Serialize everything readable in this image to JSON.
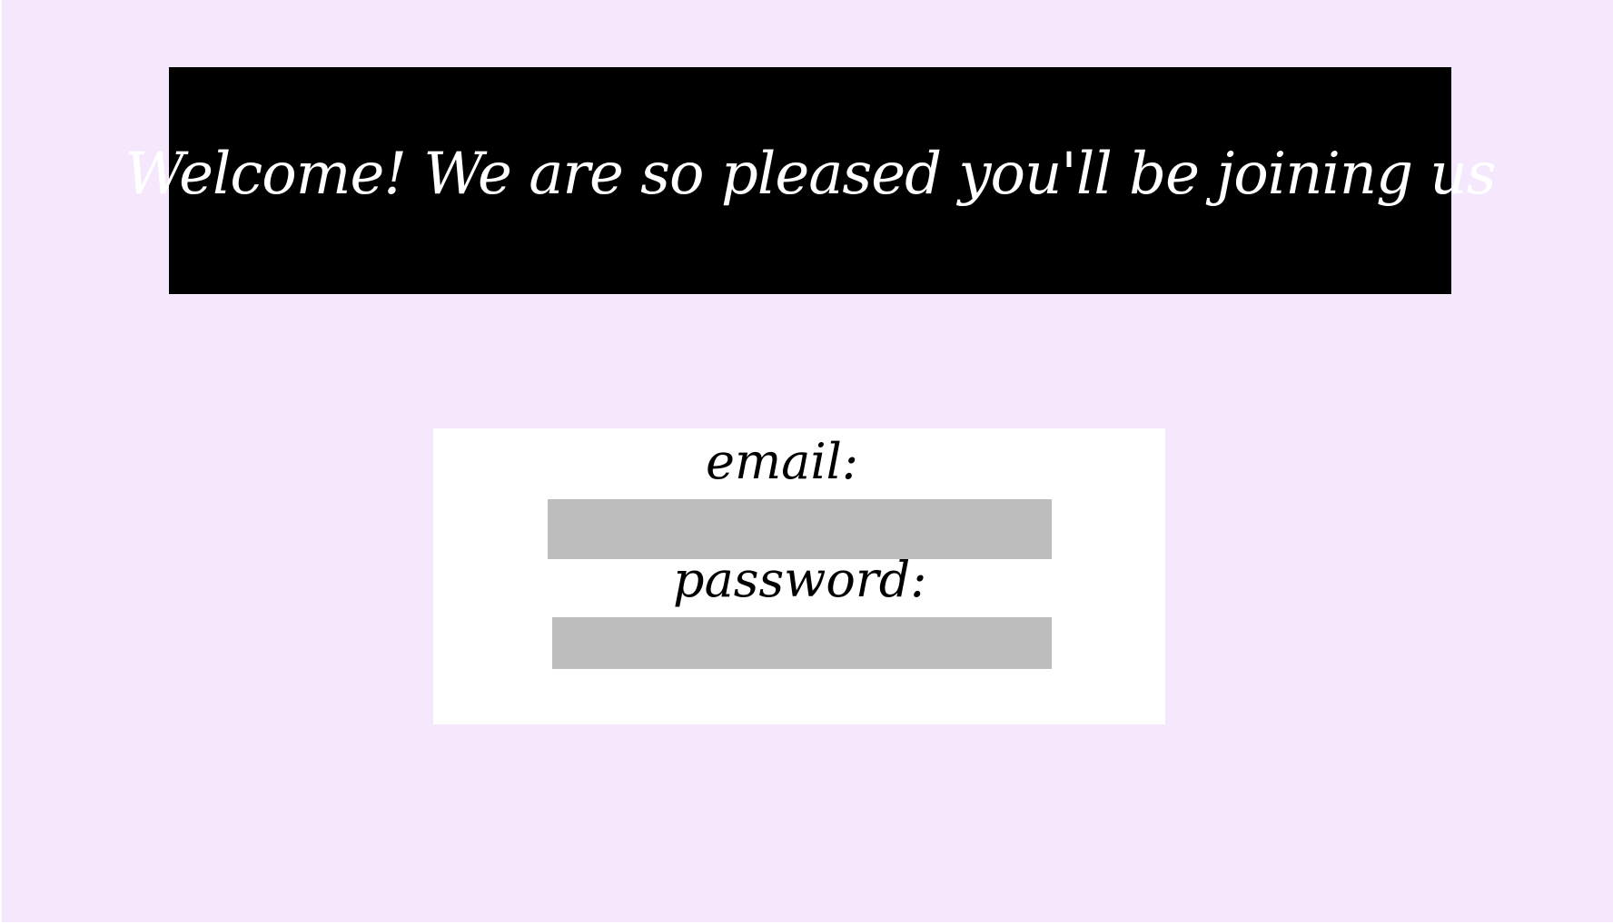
{
  "banner": {
    "title": "Welcome! We are so pleased you'll be joining us"
  },
  "login_form": {
    "email": {
      "label": "email:",
      "value": "",
      "placeholder": ""
    },
    "password": {
      "label": "password:",
      "value": "",
      "placeholder": ""
    }
  },
  "colors": {
    "page_background": "#f5e8fc",
    "banner_background": "#000000",
    "banner_text": "#ffffff",
    "card_background": "#ffffff",
    "input_background": "#bdbdbd"
  }
}
